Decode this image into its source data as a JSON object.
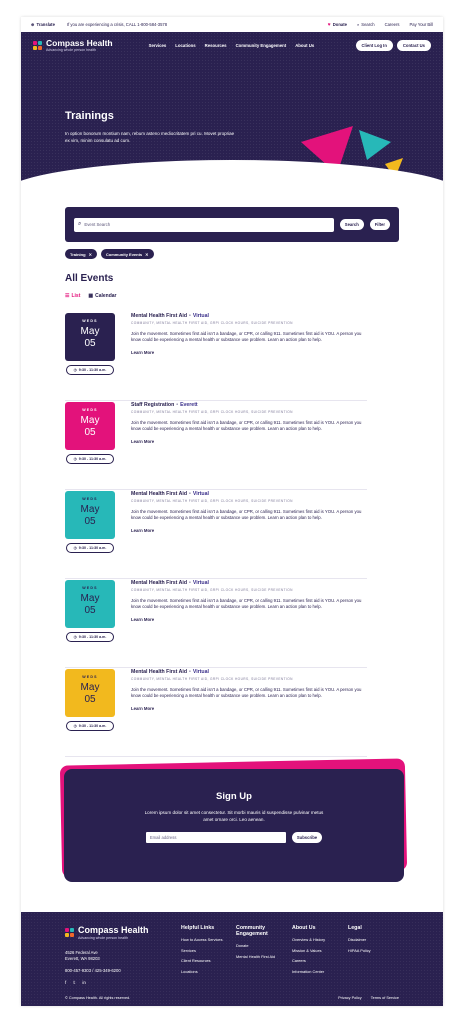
{
  "utility_bar": {
    "translate": "Translate",
    "crisis": "If you are experiencing a crisis, CALL 1-800-584-3578",
    "donate": "Donate",
    "search": "Search",
    "careers": "Careers",
    "pay_bill": "Pay Your Bill"
  },
  "brand": {
    "name": "Compass Health",
    "tagline": "Advancing whole person health"
  },
  "nav": {
    "links": [
      "Services",
      "Locations",
      "Resources",
      "Community Engagement",
      "About Us"
    ],
    "client_login": "Client Log In",
    "contact_us": "Contact Us"
  },
  "hero": {
    "title": "Trainings",
    "description": "In option bonorum montium nam, rebum asteno mediocritatem pri cu. Movet propriae ex vim, minim consulatu ad cum."
  },
  "search": {
    "placeholder": "Event Search",
    "search_label": "Search",
    "filter_label": "Filter"
  },
  "filters": [
    "Training",
    "Community Events"
  ],
  "events_section": {
    "title": "All Events",
    "view_list": "List",
    "view_calendar": "Calendar"
  },
  "events": [
    {
      "dow": "WEDS",
      "month": "May",
      "day": "05",
      "time": "9:30 - 11:30 a.m.",
      "title": "Mental Health First Aid",
      "location": "Virtual",
      "tags": "COMMUNITY, MENTAL HEALTH FIRST AID, GRPI CLOCK HOURS, SUICIDE PREVENTION",
      "description": "Join the movement. Sometimes first aid isn't a bandage, or CPR, or calling 911. Sometimes first aid is YOU. A person you know could be experiencing a mental health or substance use problem. Learn an action plan to help.",
      "more": "Learn More",
      "color": "#2a2150",
      "text_color": "#ffffff"
    },
    {
      "dow": "WEDS",
      "month": "May",
      "day": "05",
      "time": "9:30 - 11:30 a.m.",
      "title": "Staff Registration",
      "location": "Everett",
      "tags": "COMMUNITY, MENTAL HEALTH FIRST AID, GRPI CLOCK HOURS, SUICIDE PREVENTION",
      "description": "Join the movement. Sometimes first aid isn't a bandage, or CPR, or calling 911. Sometimes first aid is YOU. A person you know could be experiencing a mental health or substance use problem. Learn an action plan to help.",
      "more": "Learn More",
      "color": "#e3127b",
      "text_color": "#ffffff"
    },
    {
      "dow": "WEDS",
      "month": "May",
      "day": "05",
      "time": "9:30 - 11:30 a.m.",
      "title": "Mental Health First Aid",
      "location": "Virtual",
      "tags": "COMMUNITY, MENTAL HEALTH FIRST AID, GRPI CLOCK HOURS, SUICIDE PREVENTION",
      "description": "Join the movement. Sometimes first aid isn't a bandage, or CPR, or calling 911. Sometimes first aid is YOU. A person you know could be experiencing a mental health or substance use problem. Learn an action plan to help.",
      "more": "Learn More",
      "color": "#27b8b8",
      "text_color": "#2a2150"
    },
    {
      "dow": "WEDS",
      "month": "May",
      "day": "05",
      "time": "9:30 - 11:30 a.m.",
      "title": "Mental Health First Aid",
      "location": "Virtual",
      "tags": "COMMUNITY, MENTAL HEALTH FIRST AID, GRPI CLOCK HOURS, SUICIDE PREVENTION",
      "description": "Join the movement. Sometimes first aid isn't a bandage, or CPR, or calling 911. Sometimes first aid is YOU. A person you know could be experiencing a mental health or substance use problem. Learn an action plan to help.",
      "more": "Learn More",
      "color": "#27b8b8",
      "text_color": "#2a2150"
    },
    {
      "dow": "WEDS",
      "month": "May",
      "day": "05",
      "time": "9:30 - 11:30 a.m.",
      "title": "Mental Health First Aid",
      "location": "Virtual",
      "tags": "COMMUNITY, MENTAL HEALTH FIRST AID, GRPI CLOCK HOURS, SUICIDE PREVENTION",
      "description": "Join the movement. Sometimes first aid isn't a bandage, or CPR, or calling 911. Sometimes first aid is YOU. A person you know could be experiencing a mental health or substance use problem. Learn an action plan to help.",
      "more": "Learn More",
      "color": "#f2b91e",
      "text_color": "#2a2150"
    }
  ],
  "signup": {
    "title": "Sign Up",
    "text": "Lorem ipsum dolor sit amet consectetur. Sit morbi mauris id suspendisse pulvinar metus amet ornare orci. Leo aenean.",
    "email_placeholder": "Email address",
    "button": "Subscribe"
  },
  "footer": {
    "address_line1": "4526 Federal Ave",
    "address_line2": "Everett, WA 98203",
    "phones": "800-457-9303 / 425-349-6200",
    "columns": [
      {
        "heading": "Helpful Links",
        "links": [
          "How to Access Services",
          "Services",
          "Client Resources",
          "Locations"
        ]
      },
      {
        "heading": "Community Engagement",
        "links": [
          "Donate",
          "Mental Health First Aid"
        ]
      },
      {
        "heading": "About Us",
        "links": [
          "Overview & History",
          "Mission & Values",
          "Careers",
          "Information Center"
        ]
      },
      {
        "heading": "Legal",
        "links": [
          "Disclaimer",
          "HIPAA Policy"
        ]
      }
    ],
    "copyright": "© Compass Health. All rights reserved.",
    "privacy": "Privacy Policy",
    "terms": "Terms of Service"
  },
  "colors": {
    "navy": "#2a2150",
    "magenta": "#e3127b",
    "teal": "#27b8b8",
    "yellow": "#f2b91e",
    "orange": "#f0682c"
  }
}
